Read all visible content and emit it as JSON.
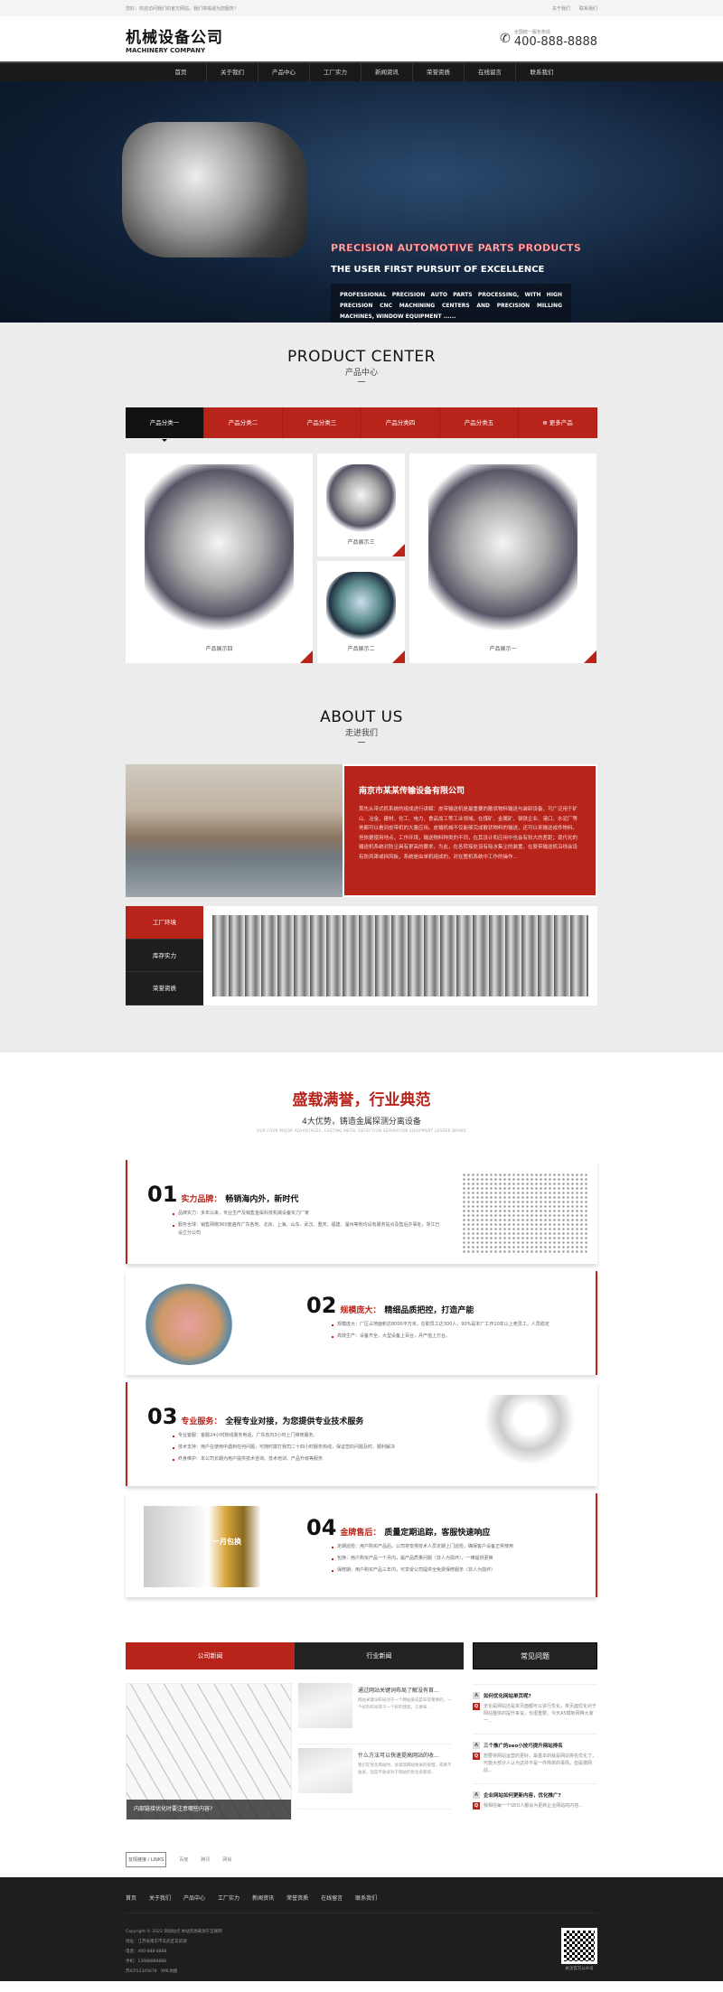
{
  "topbar": {
    "welcome": "您好，欢迎访问我们的官方网站，我们将竭诚为您服务！",
    "links": [
      "关于我们",
      "联系我们"
    ]
  },
  "header": {
    "logo_cn": "机械设备公司",
    "logo_en": "MACHINERY COMPANY",
    "phone_label": "全国统一服务热线",
    "phone": "400-888-8888"
  },
  "nav": [
    "首页",
    "关于我们",
    "产品中心",
    "工厂实力",
    "新闻资讯",
    "荣誉资质",
    "在线留言",
    "联系我们"
  ],
  "banner": {
    "title": "PRECISION AUTOMOTIVE PARTS PRODUCTS",
    "subtitle": "THE USER FIRST PURSUIT OF EXCELLENCE",
    "desc": "PROFESSIONAL PRECISION AUTO PARTS PROCESSING, WITH HIGH PRECISION CNC MACHINING CENTERS AND PRECISION MILLING MACHINES, WINDOW EQUIPMENT ......",
    "slides": 2,
    "active_slide": 1
  },
  "products": {
    "title_en": "PRODUCT CENTER",
    "title_cn": "产品中心",
    "tabs": [
      "产品分类一",
      "产品分类二",
      "产品分类三",
      "产品分类四",
      "产品分类五",
      "更多产品"
    ],
    "items": [
      "产品展示四",
      "产品展示三",
      "产品展示二",
      "产品展示一"
    ]
  },
  "about": {
    "title_en": "ABOUT US",
    "title_cn": "走进我们",
    "company": "南京市某某传输设备有限公司",
    "text": "首先从带式机系统的组成进行讲解：皮带输送机是最重要的散状物料输送与装卸设备，可广泛用于矿山、冶金、建材、化工、电力、食品加工等工业领域。在煤矿、金属矿、钢铁企业、港口、水泥厂等地都可以看到皮带机的大量应用。皮输机械不仅能够完成散状物料的输送，还可以来输送成件物料。但依据使用地点，工作环境，输送物料种类的不同，在其设计和应用中也会有较大的差距；现代化的输送机系统对防尘具有更高的要求，为此，在各转接处设有吸水集尘的装置，在胶带输送机沿线会设有防风罩或挡风板，系统是由单机组成的，对在整机系统中工作的操作...",
    "tabs": [
      "工厂环境",
      "库存实力",
      "荣誉资质"
    ]
  },
  "advantages": {
    "title": "盛载满誉，行业典范",
    "subtitle": "4大优势，铸造金属探测分离设备",
    "subtitle_en": "OUR FOUR MAJOR ADVANTAGES, CASTING METAL DETECTION SEPARATION EQUIPMENT LEADER BRAND",
    "items": [
      {
        "no": "01",
        "key": "实力品牌：",
        "title": "畅销海内外，新时代",
        "points": [
          "品牌实力：多年以来，专业生产及销售金属科技机械设备实力厂家",
          "服务全球：销售网络360度遍布广东各地、北京、上海、山东、武汉、重庆、福建、温州等地均设有服务站点及售后办事处，浙江已设立分公司"
        ]
      },
      {
        "no": "02",
        "key": "规模庞大：",
        "title": "精细品质把控，打造产能",
        "points": [
          "规模庞大：厂区占地面积达8000平方米，在职员工达300人，90%是本厂工作10年以上老员工，人员稳定",
          "高效生产：设备齐全，大型设备上百台，月产值上万台。"
        ]
      },
      {
        "no": "03",
        "key": "专业服务：",
        "title": "全程专业对接，为您提供专业技术服务",
        "points": [
          "专业客服：客服24小时热线服务电话，广东省内3小时上门维修服务。",
          "技术支持：用户在使用中遇到任何问题，可随时拨打我司二十四小时服务热线，保证您的问题及时、顺利解决",
          "终身维护：本公司长期为用户提供技术咨询、技术培训、产品升级等服务"
        ]
      },
      {
        "no": "04",
        "key": "金牌售后：",
        "title": "质量定期追踪，客服快速响应",
        "points": [
          "定期巡检：用户购买产品后，公司将安排技术人员定期上门巡检，确保客户设备正常使用",
          "包换：用户购买产品一个月内，属产品质量问题（非人为损坏），一律提供更换",
          "保修期：用户购买产品三年内，可享受公司提供全免费保修服务（非人为损坏）"
        ]
      }
    ],
    "badge": "一月包换"
  },
  "news": {
    "tabs": [
      "公司新闻",
      "行业新闻"
    ],
    "featured": "内部链接优化时要注意哪些内容?",
    "items": [
      {
        "title": "通过网站关键词布局了解没有首...",
        "summary": "网站关键词布局对于一个网站来说是非常重要的，一个好的布局等于一个好的建筑，只要布..."
      },
      {
        "title": "什么方法可以快速提高网站的收...",
        "summary": "我们在优化网站时，会发现网站收录的很慢，或者不收录，但是不收录对于网站的优化有影响..."
      }
    ]
  },
  "faq": {
    "title": "常见问题",
    "items": [
      {
        "q": "如何优化网站单页呢?",
        "a": "无论是网站还是单页面都可以进行优化，单页面优化对于网站整体的提升来说，也很重要，今天A5模板网带大家一..."
      },
      {
        "q": "三个推广的seo小技巧提升网站排名",
        "a": "想要将网站运营的更好，最基本的就是网站排名优化了，可能大部分人认为这并不是一件简单的事情，但是做网站..."
      },
      {
        "q": "企业网站如何更新内容，优化推广?",
        "a": "我相信每一个SEO人都会为更新企业网站的内容..."
      }
    ]
  },
  "links": {
    "label": "友情链接 / LINKS",
    "items": [
      "百度",
      "腾讯",
      "网易"
    ]
  },
  "footer": {
    "nav": [
      "首页",
      "关于我们",
      "产品中心",
      "工厂实力",
      "新闻资讯",
      "荣誉资质",
      "在线留言",
      "联系我们"
    ],
    "copyright": "Copyright © 2022 测试站点 本站资源来源于互联网",
    "address": "地址：江苏省南京市玄武区玄武湖",
    "tel": "电话：400-888-8888",
    "mobile": "手机：13988888888",
    "icp": "苏ICP12345678",
    "sitemap": "XML地图",
    "qr_label": "关注官方公众号"
  },
  "colors": {
    "accent": "#b8241a",
    "dark": "#1e1e1e"
  }
}
